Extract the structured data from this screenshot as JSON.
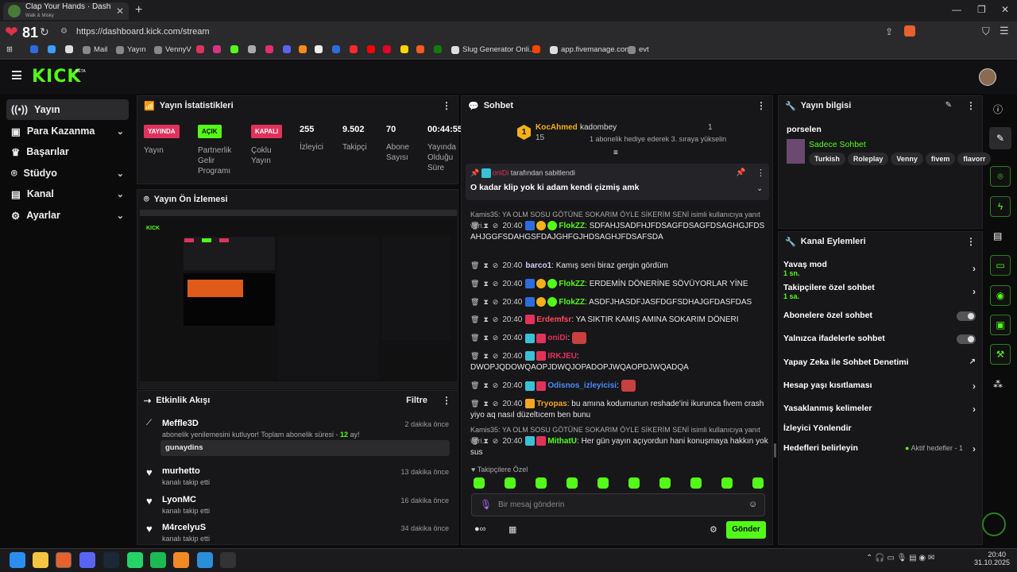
{
  "browser": {
    "tab_title": "Clap Your Hands · Dashboard",
    "tab_subtitle": "Walk & Misky",
    "url": "https://dashboard.kick.com/stream",
    "health": "81",
    "bookmarks": [
      "Mail",
      "Yayın",
      "VennyV",
      "Slug Generator Onli...",
      "app.fivemanage.com",
      "evt"
    ]
  },
  "app": {
    "logo": "KICK",
    "beta": "BETA"
  },
  "sidebar": {
    "items": [
      {
        "label": "Yayın",
        "icon": "broadcast-icon"
      },
      {
        "label": "Para Kazanma",
        "icon": "wallet-icon"
      },
      {
        "label": "Başarılar",
        "icon": "trophy-icon"
      },
      {
        "label": "Stüdyo",
        "icon": "studio-icon"
      },
      {
        "label": "Kanal",
        "icon": "channel-icon"
      },
      {
        "label": "Ayarlar",
        "icon": "settings-icon"
      }
    ]
  },
  "stats": {
    "title": "Yayın İstatistikleri",
    "badges": [
      {
        "label": "YAYINDA",
        "desc": "Yayın",
        "color": "#e0325b"
      },
      {
        "label": "AÇIK",
        "desc": "Partnerlik Gelir Programı",
        "color": "#53fc18"
      },
      {
        "label": "KAPALI",
        "desc": "Çoklu Yayın",
        "color": "#e0325b"
      }
    ],
    "values": [
      {
        "value": "255",
        "label": "İzleyici"
      },
      {
        "value": "9.502",
        "label": "Takipçi"
      },
      {
        "value": "70",
        "label": "Abone Sayısı"
      },
      {
        "value": "00:44:55",
        "label": "Yayında Olduğu Süre"
      }
    ]
  },
  "preview": {
    "title": "Yayın Ön İzlemesi"
  },
  "events": {
    "title": "Etkinlik Akışı",
    "filter": "Filtre",
    "items": [
      {
        "name": "Meffle3D",
        "desc": "abonelik yenilemesini kutluyor! Toplam abonelik süresi - ",
        "months": "12",
        "months_suffix": " ay!",
        "time": "2 dakika önce",
        "message": "gunaydins"
      },
      {
        "name": "murhetto",
        "desc": "kanalı takip etti",
        "time": "13 dakika önce"
      },
      {
        "name": "LyonMC",
        "desc": "kanalı takip etti",
        "time": "16 dakika önce"
      },
      {
        "name": "M4rcelyuS",
        "desc": "kanalı takip etti",
        "time": "34 dakika önce"
      }
    ]
  },
  "chat": {
    "title": "Sohbet",
    "top": {
      "user1": "KocAhmed",
      "user1_count": "15",
      "user2": "kadombey",
      "user2_count": "1",
      "gift_text": "1 abonelik hediye ederek 3. sıraya yükselin"
    },
    "pinned": {
      "by": "oniDi",
      "by_suffix": "tarafından sabitlendi",
      "text": "O kadar klip yok ki adam kendi çizmiş amk"
    },
    "messages": [
      {
        "reply": "Kamis35: YA OLM SOSU GÖTÜNE SOKARIM ÖYLE SİKERİM SENİ isimli kullanıcıya yanıt veri..."
      },
      {
        "time": "20:40",
        "user": "FlokZZ",
        "color": "#53fc18",
        "text": "SDFAHJSADFHJFDSAGFDSAGFDSAGHGJFDSAHJGGFSDAHGSFDAJGHFGJHDSAGHJFDSAFSDA"
      },
      {
        "time": "20:40",
        "user": "barco1",
        "color": "#d7c9ff",
        "text": "Kamış seni biraz gergin gördüm"
      },
      {
        "time": "20:40",
        "user": "FlokZZ",
        "color": "#53fc18",
        "text": "ERDEMİN DÖNERİNE SÖVÜYORLAR YİNE"
      },
      {
        "time": "20:40",
        "user": "FlokZZ",
        "color": "#53fc18",
        "text": "ASDFJHASDFJASFDGFSDHAJGFDASFDAS"
      },
      {
        "time": "20:40",
        "user": "Erdemfsr",
        "color": "#ff4a5a",
        "text": "YA SIKTIR KAMIŞ AMINA SOKARIM DÖNERI"
      },
      {
        "time": "20:40",
        "user": "oniDi",
        "color": "#e0325b",
        "text": ""
      },
      {
        "time": "20:40",
        "user": "IRKJEU",
        "color": "#e0325b",
        "text": "DWOPJQDOWQAOPJDWQJOPADOPJWQAOPDJWQADQA"
      },
      {
        "time": "20:40",
        "user": "Odisnos_izleyicisi",
        "color": "#4a8cff",
        "text": ""
      },
      {
        "time": "20:40",
        "user": "Tryopas",
        "color": "#f5a623",
        "text": "bu amına kodumunun reshade'ini ikurunca fivem crash yiyo aq nasıl düzeltıcem ben bunu"
      },
      {
        "reply": "Kamis35: YA OLM SOSU GÖTÜNE SOKARIM ÖYLE SİKERİM SENİ isimli kullanıcıya yanıt veri..."
      },
      {
        "time": "20:40",
        "user": "MithatU",
        "color": "#53fc18",
        "text": "Her gün yayın açıyordun hani konuşmaya hakkın yok sus"
      }
    ],
    "emote_label": "Takipçilere Özel",
    "input_placeholder": "Bir mesaj gönderin",
    "send": "Gönder"
  },
  "stream_info": {
    "title": "Yayın bilgisi",
    "stream_title": "porselen",
    "category": "Sadece Sohbet",
    "tags": [
      "Turkish",
      "Roleplay",
      "Venny",
      "fivem",
      "flavorr"
    ]
  },
  "channel_actions": {
    "title": "Kanal Eylemleri",
    "items": [
      {
        "label": "Yavaş mod",
        "sub": "1 sn.",
        "control": "chevron"
      },
      {
        "label": "Takipçilere özel sohbet",
        "sub": "1 sa.",
        "control": "chevron"
      },
      {
        "label": "Abonelere özel sohbet",
        "control": "toggle"
      },
      {
        "label": "Yalnızca ifadelerle sohbet",
        "control": "toggle"
      },
      {
        "label": "Yapay Zeka ile Sohbet Denetimi",
        "control": "external"
      },
      {
        "label": "Hesap yaşı kısıtlaması",
        "control": "chevron"
      },
      {
        "label": "Yasaklanmış kelimeler",
        "control": "chevron"
      },
      {
        "label": "İzleyici Yönlendir",
        "control": "none"
      },
      {
        "label": "Hedefleri belirleyin",
        "right": "Aktif hedefler - 1",
        "control": "chevron"
      }
    ]
  },
  "taskbar": {
    "time": "20:40",
    "date": "31.10.2025"
  }
}
